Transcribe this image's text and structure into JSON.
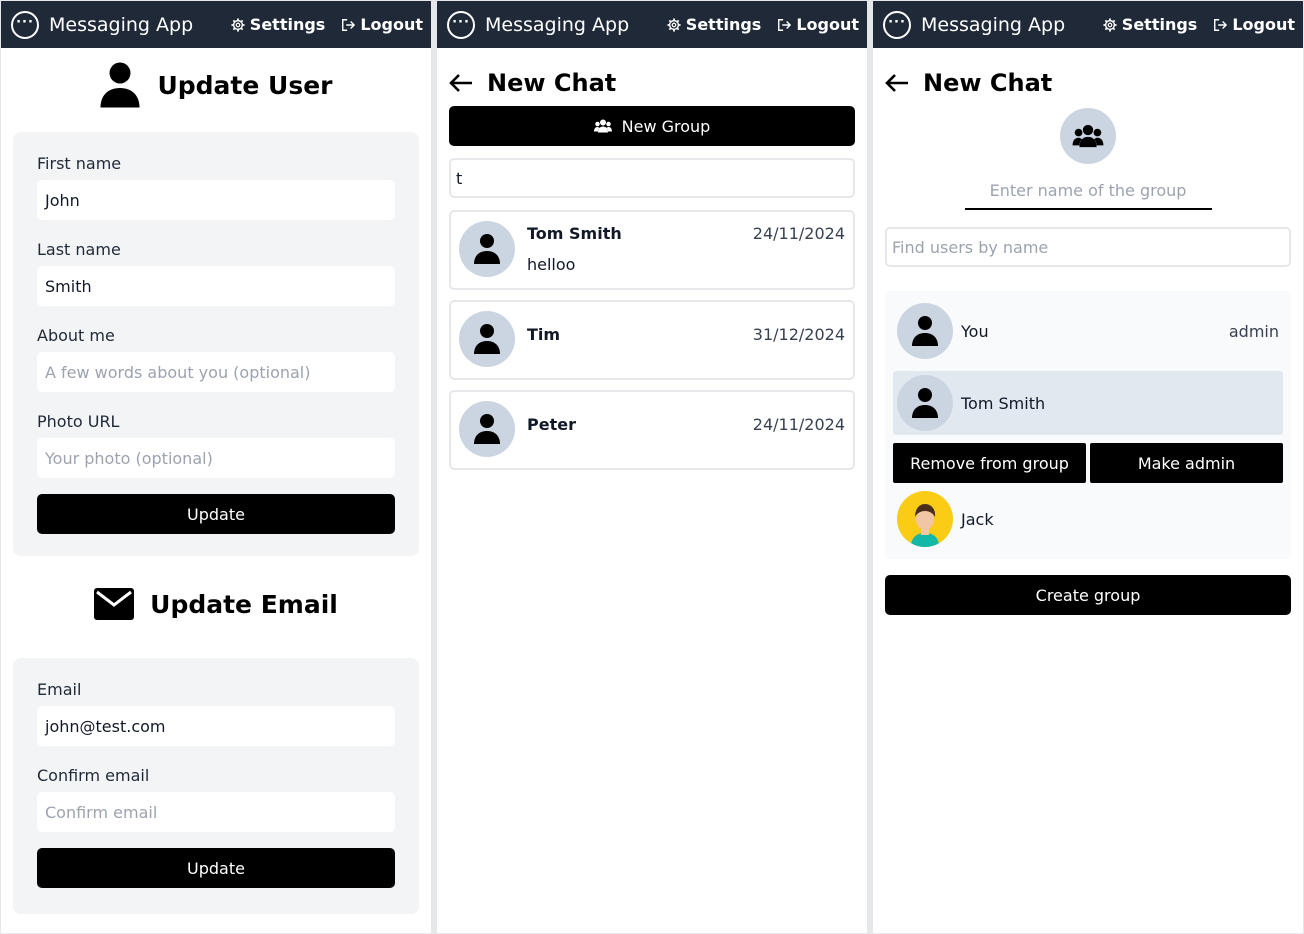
{
  "navbar": {
    "app_title": "Messaging App",
    "settings_label": "Settings",
    "logout_label": "Logout"
  },
  "update_user": {
    "title": "Update User",
    "first_name_label": "First name",
    "first_name_value": "John",
    "last_name_label": "Last name",
    "last_name_value": "Smith",
    "about_label": "About me",
    "about_placeholder": "A few words about you (optional)",
    "photo_label": "Photo URL",
    "photo_placeholder": "Your photo (optional)",
    "button": "Update"
  },
  "update_email": {
    "title": "Update Email",
    "email_label": "Email",
    "email_value": "john@test.com",
    "confirm_label": "Confirm email",
    "confirm_placeholder": "Confirm email",
    "button": "Update"
  },
  "new_chat": {
    "title": "New Chat",
    "new_group_button": "New Group",
    "search_value": "t",
    "results": [
      {
        "name": "Tom Smith",
        "date": "24/11/2024",
        "message": "helloo"
      },
      {
        "name": "Tim",
        "date": "31/12/2024",
        "message": ""
      },
      {
        "name": "Peter",
        "date": "24/11/2024",
        "message": ""
      }
    ]
  },
  "new_group": {
    "title": "New Chat",
    "group_name_placeholder": "Enter name of the group",
    "find_users_placeholder": "Find users by name",
    "members": [
      {
        "name": "You",
        "role": "admin"
      },
      {
        "name": "Tom Smith",
        "role": ""
      },
      {
        "name": "Jack",
        "role": ""
      }
    ],
    "remove_button": "Remove from group",
    "make_admin_button": "Make admin",
    "create_button": "Create group"
  },
  "colors": {
    "navbar": "#1f2937",
    "avatar_bg": "#cbd5e1",
    "card_bg": "#f3f4f6",
    "selected_member": "#e2e8f0",
    "button": "#000000"
  },
  "icons": [
    "chat-bubble-icon",
    "gear-icon",
    "logout-icon",
    "user-icon",
    "envelope-icon",
    "arrow-left-icon",
    "users-group-icon"
  ]
}
